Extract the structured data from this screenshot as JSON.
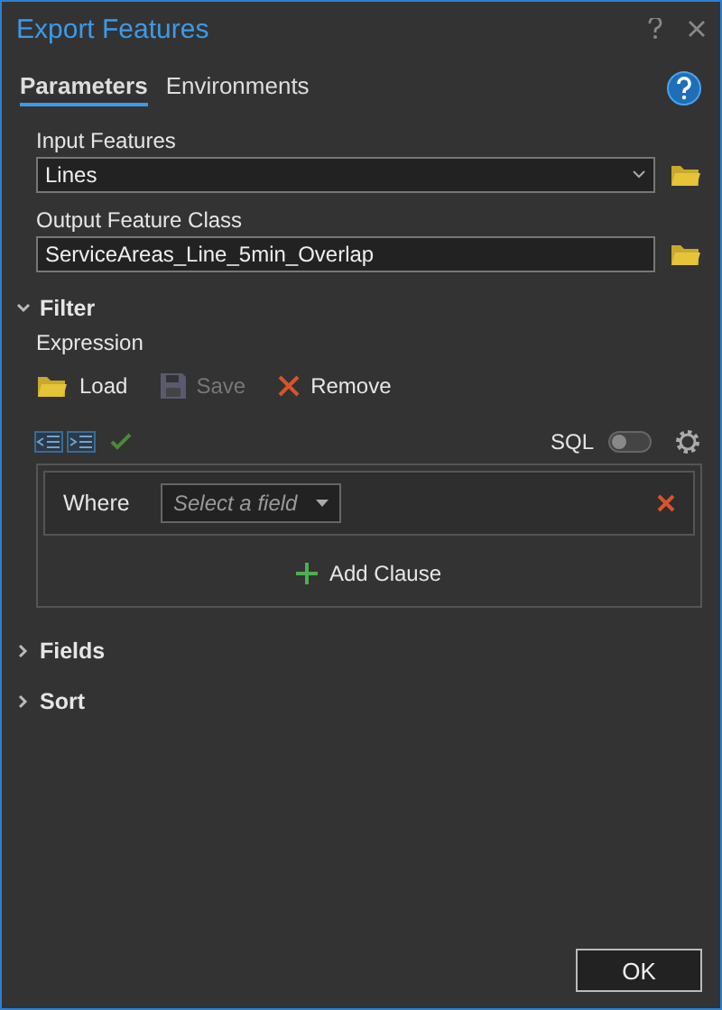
{
  "window": {
    "title": "Export Features"
  },
  "tabs": [
    {
      "label": "Parameters",
      "selected": true
    },
    {
      "label": "Environments",
      "selected": false
    }
  ],
  "parameters": [
    {
      "label": "Input Features",
      "value": "Lines",
      "kind": "dropdown"
    },
    {
      "label": "Output Feature Class",
      "value": "ServiceAreas_Line_5min_Overlap",
      "kind": "text"
    }
  ],
  "sections": [
    {
      "title": "Filter",
      "expanded": true
    },
    {
      "title": "Fields",
      "expanded": false
    },
    {
      "title": "Sort",
      "expanded": false
    }
  ],
  "filter": {
    "label": "Expression",
    "actions": [
      {
        "label": "Load",
        "kind": "load",
        "disabled": false
      },
      {
        "label": "Save",
        "kind": "save",
        "disabled": true
      },
      {
        "label": "Remove",
        "kind": "remove",
        "disabled": false
      }
    ],
    "sql_toggle": {
      "label": "SQL",
      "on": false
    },
    "clause": {
      "label": "Where",
      "placeholder": "Select a field"
    },
    "add_clause": "Add Clause"
  },
  "buttons": [
    "OK"
  ]
}
